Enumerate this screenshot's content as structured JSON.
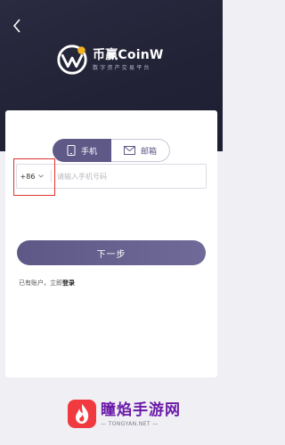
{
  "header": {
    "brand": "币赢CoinW",
    "slogan": "数字资产交易平台"
  },
  "tabs": [
    {
      "label": "手机",
      "icon": "phone-icon",
      "active": true
    },
    {
      "label": "邮箱",
      "icon": "mail-icon",
      "active": false
    }
  ],
  "phone": {
    "country_code": "+86",
    "placeholder": "请输入手机号码"
  },
  "next_button": "下一步",
  "login": {
    "prefix": "已有账户，立即",
    "link": "登录"
  },
  "watermark": {
    "title": "瞳焰手游网",
    "url": "— TONGYAN.NET —"
  },
  "colors": {
    "header_bg": "#222236",
    "accent": "#5e5987",
    "highlight": "#e0332f"
  }
}
